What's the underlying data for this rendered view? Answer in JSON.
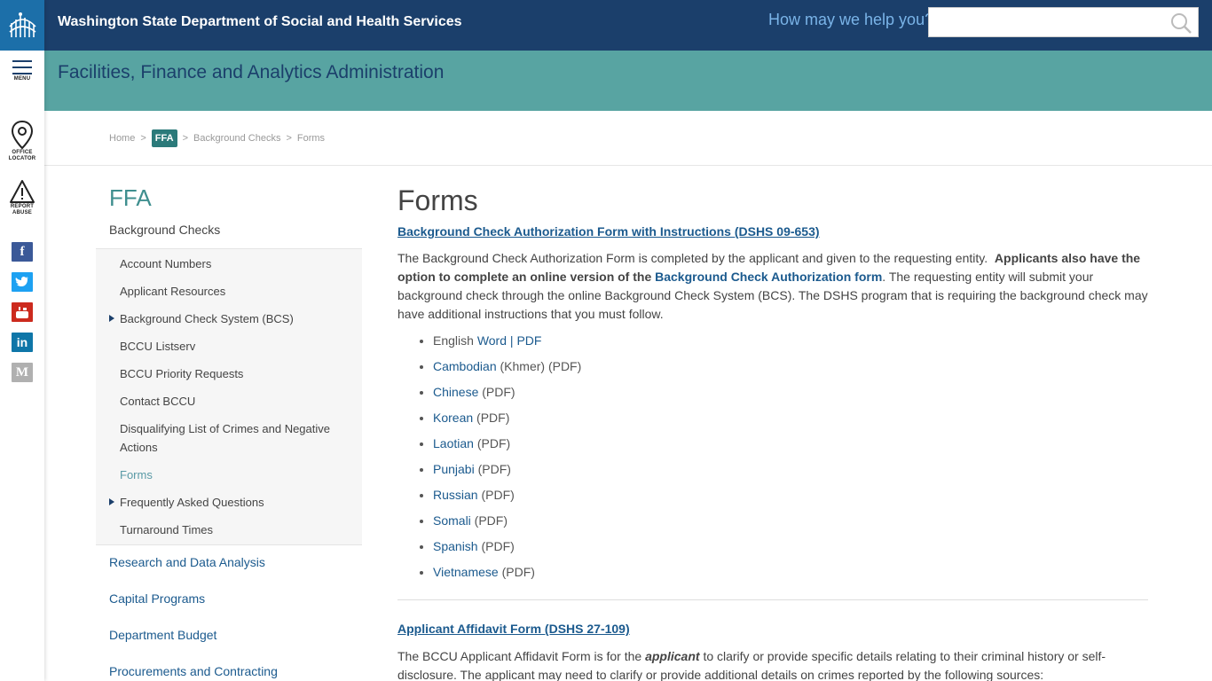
{
  "header": {
    "agency_name": "Washington State Department of Social and Health Services",
    "help_text": "How may we help you?",
    "search_placeholder": ""
  },
  "rail": {
    "menu_label": "MENU",
    "office_label_1": "OFFICE",
    "office_label_2": "LOCATOR",
    "report_label_1": "REPORT",
    "report_label_2": "ABUSE",
    "social_icons": [
      "facebook-icon",
      "twitter-icon",
      "youtube-icon",
      "linkedin-icon",
      "medium-icon"
    ],
    "social_colors": [
      "#3b5998",
      "#1da1f2",
      "#cc2a1e",
      "#0e76a8",
      "#b0b0b0"
    ]
  },
  "banner": {
    "title": "Facilities, Finance and Analytics Administration"
  },
  "breadcrumb": {
    "home": "Home",
    "sep": ">",
    "ffa": "FFA",
    "background_checks": "Background Checks",
    "forms": "Forms"
  },
  "sidebar": {
    "title": "FFA",
    "section": "Background Checks",
    "items": [
      {
        "label": "Account Numbers",
        "expandable": false,
        "active": false
      },
      {
        "label": "Applicant Resources",
        "expandable": false,
        "active": false
      },
      {
        "label": "Background Check System (BCS)",
        "expandable": true,
        "active": false
      },
      {
        "label": "BCCU Listserv",
        "expandable": false,
        "active": false
      },
      {
        "label": "BCCU Priority Requests",
        "expandable": false,
        "active": false
      },
      {
        "label": "Contact BCCU",
        "expandable": false,
        "active": false
      },
      {
        "label": "Disqualifying List of Crimes and Negative Actions",
        "expandable": false,
        "active": false
      },
      {
        "label": "Forms",
        "expandable": false,
        "active": true
      },
      {
        "label": "Frequently Asked Questions",
        "expandable": true,
        "active": false
      },
      {
        "label": "Turnaround Times",
        "expandable": false,
        "active": false
      }
    ],
    "links": [
      "Research and Data Analysis",
      "Capital Programs",
      "Department Budget",
      "Procurements and Contracting"
    ]
  },
  "main": {
    "title": "Forms",
    "form1": {
      "link": "Background Check Authorization Form with Instructions (DSHS 09-653)",
      "p1": "The Background Check Authorization Form is completed by the applicant and given to the requesting entity.",
      "p1_bold": "Applicants also have the option to complete an online version of the",
      "p1_link": "Background Check Authorization form",
      "p1_end": ". The requesting entity will submit your background check through the online Background Check System (BCS).  The DSHS program that is requiring the background check may have additional instructions that you must follow.",
      "languages": [
        {
          "lang": "English",
          "word": "Word",
          "bar": "|",
          "pdf": "PDF"
        },
        {
          "lang": "Cambodian",
          "suffix": " (Khmer) (PDF)"
        },
        {
          "lang": "Chinese",
          "suffix": " (PDF)"
        },
        {
          "lang": "Korean",
          "suffix": " (PDF)"
        },
        {
          "lang": "Laotian",
          "suffix": " (PDF)"
        },
        {
          "lang": "Punjabi",
          "suffix": " (PDF)"
        },
        {
          "lang": "Russian",
          "suffix": " (PDF)"
        },
        {
          "lang": "Somali",
          "suffix": " (PDF)"
        },
        {
          "lang": "Spanish",
          "suffix": " (PDF)"
        },
        {
          "lang": "Vietnamese",
          "suffix": " (PDF)"
        }
      ]
    },
    "form2": {
      "link": "Applicant Affidavit Form (DSHS 27-109)",
      "p_start": "The BCCU Applicant Affidavit Form is for the",
      "p_em": "applicant",
      "p_end": "to clarify or provide specific details relating to their criminal history or self-disclosure. The applicant may need to clarify or provide additional details on crimes reported by the following sources:"
    }
  }
}
